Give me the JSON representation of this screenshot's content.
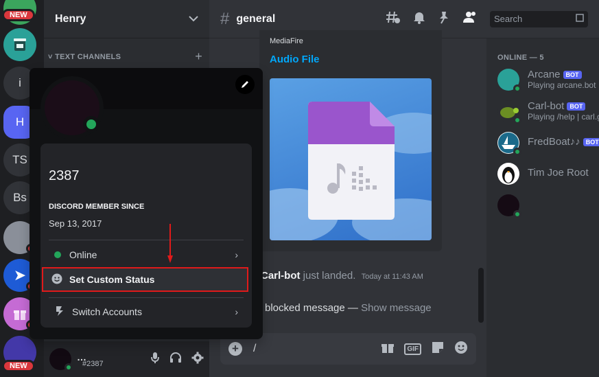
{
  "rail": {
    "new_badge": "NEW",
    "servers": [
      {
        "label": ""
      },
      {
        "label": "i"
      },
      {
        "label": "H"
      },
      {
        "label": "TS"
      },
      {
        "label": "Bs"
      }
    ]
  },
  "guild": {
    "name": "Henry",
    "category": "TEXT CHANNELS"
  },
  "userbar": {
    "tag": "#2387"
  },
  "channel": {
    "name": "general",
    "search_placeholder": "Search"
  },
  "embed": {
    "provider": "MediaFire",
    "title": "Audio File"
  },
  "messages": {
    "m1_author": "Carl-bot",
    "m1_text": "just landed.",
    "m1_time": "Today at 11:43 AM",
    "m2_text": "blocked message —",
    "m2_link": "Show message"
  },
  "composer": {
    "value": "/",
    "gif_label": "GIF"
  },
  "members": {
    "header": "ONLINE — 5",
    "list": [
      {
        "name": "Arcane",
        "bot": "BOT",
        "activity": "Playing arcane.bot"
      },
      {
        "name": "Carl-bot",
        "bot": "BOT",
        "activity": "Playing /help | carl.g"
      },
      {
        "name": "FredBoat♪♪",
        "bot": "BOT",
        "activity": ""
      },
      {
        "name": "Tim Joe Root",
        "bot": "",
        "activity": ""
      },
      {
        "name": "",
        "bot": "",
        "activity": ""
      }
    ]
  },
  "popout": {
    "username": "2387",
    "member_since_label": "DISCORD MEMBER SINCE",
    "member_since_date": "Sep 13, 2017",
    "status_label": "Online",
    "custom_status_label": "Set Custom Status",
    "switch_label": "Switch Accounts"
  },
  "colors": {
    "accent": "#5865f2",
    "online": "#23a55a",
    "highlight": "#e11a1a",
    "link": "#00a8fc"
  }
}
